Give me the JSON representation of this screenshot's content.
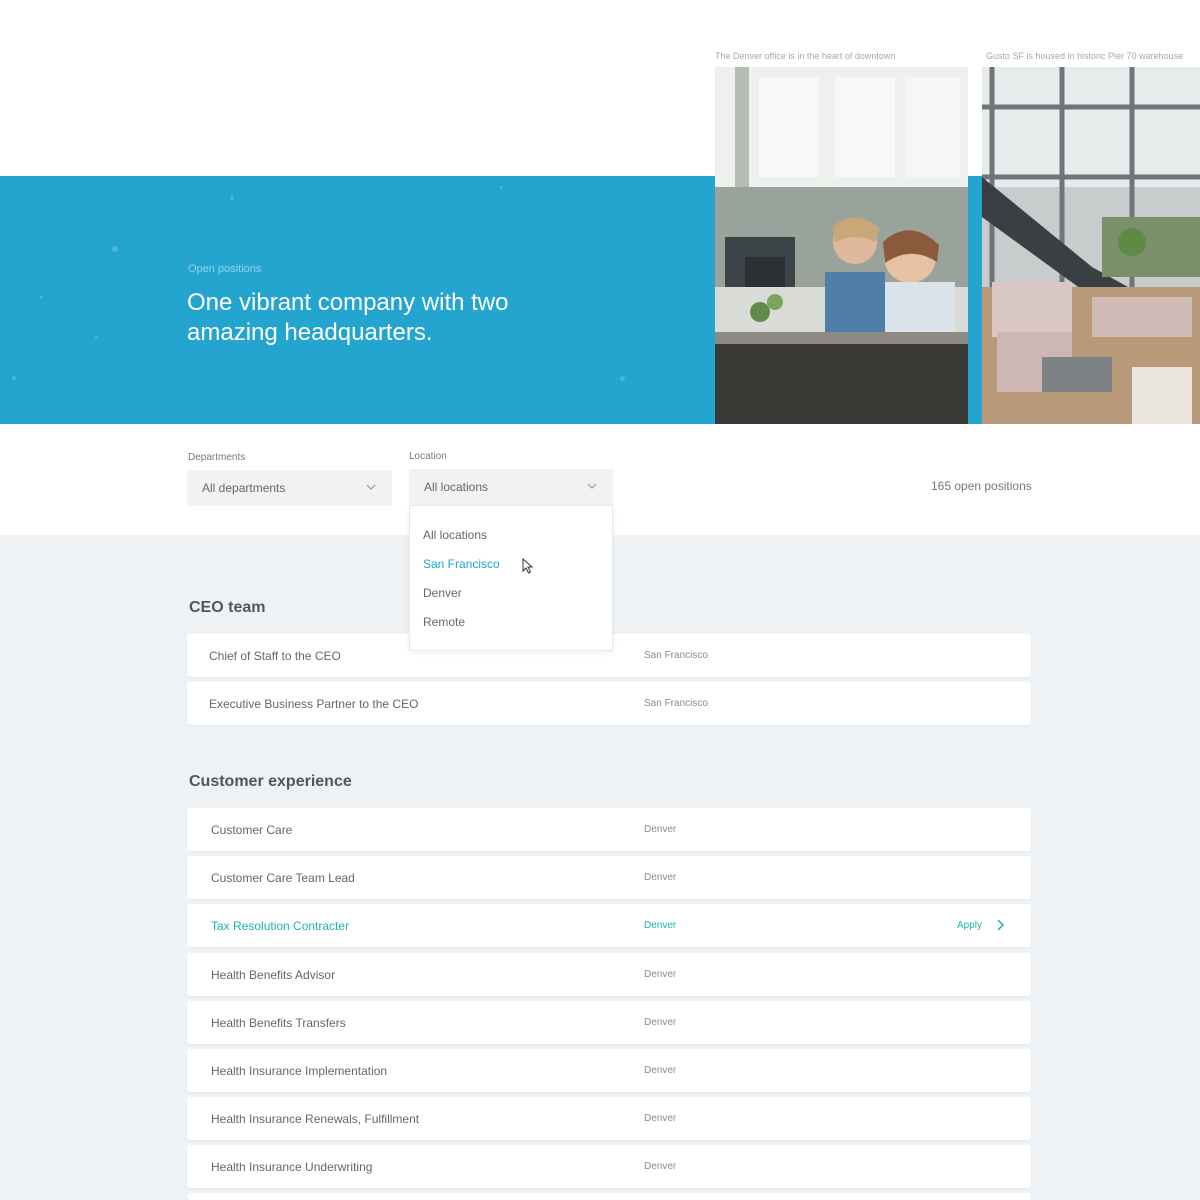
{
  "hero": {
    "eyebrow": "Open positions",
    "title": "One vibrant company with two amazing headquarters.",
    "accent_color": "#24a5d0"
  },
  "photos": [
    {
      "caption": "The Denver office is in the heart of downtown",
      "icon": "office-photo"
    },
    {
      "caption": "Gusto SF is housed in historic Pier 70 warehouse",
      "icon": "office-photo"
    }
  ],
  "filters": {
    "departments": {
      "label": "Departments",
      "value": "All departments"
    },
    "location": {
      "label": "Location",
      "value": "All locations",
      "options": [
        "All locations",
        "San Francisco",
        "Denver",
        "Remote"
      ],
      "highlighted": "San Francisco"
    },
    "count_text": "165 open positions"
  },
  "sections": [
    {
      "title": "CEO team",
      "jobs": [
        {
          "title": "Chief of Staff to the CEO",
          "location": "San Francisco"
        },
        {
          "title": "Executive Business Partner to the CEO",
          "location": "San Francisco"
        }
      ]
    },
    {
      "title": "Customer experience",
      "jobs": [
        {
          "title": "Customer Care",
          "location": "Denver"
        },
        {
          "title": "Customer Care Team Lead",
          "location": "Denver"
        },
        {
          "title": "Tax Resolution Contracter",
          "location": "Denver",
          "active": true,
          "apply": "Apply"
        },
        {
          "title": "Health Benefits Advisor",
          "location": "Denver"
        },
        {
          "title": "Health Benefits Transfers",
          "location": "Denver"
        },
        {
          "title": "Health Insurance Implementation",
          "location": "Denver"
        },
        {
          "title": "Health Insurance Renewals, Fulfillment",
          "location": "Denver"
        },
        {
          "title": "Health Insurance Underwriting",
          "location": "Denver"
        }
      ]
    }
  ],
  "colors": {
    "link": "#1bb3b1",
    "highlight": "#1ba6cf",
    "content_bg": "#eef2f5"
  }
}
